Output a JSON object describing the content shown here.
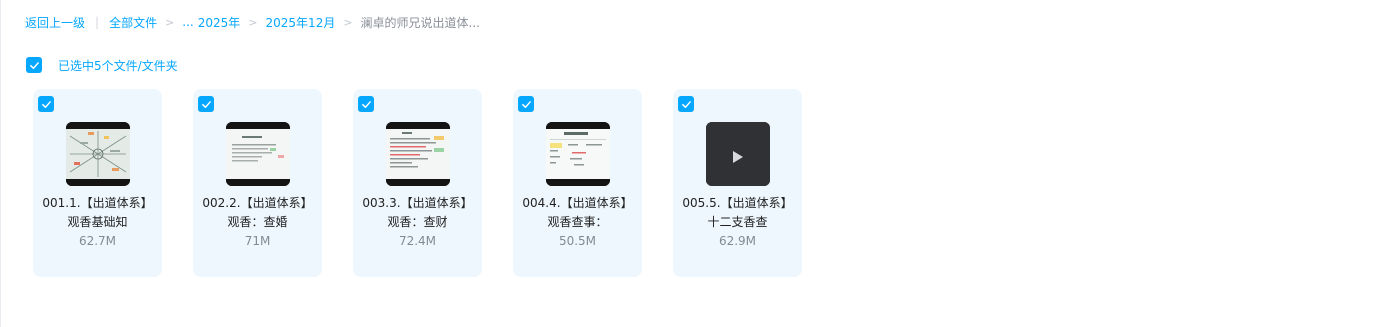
{
  "breadcrumb": {
    "back": "返回上一级",
    "all_files": "全部文件",
    "ellipsis": "...",
    "year": "2025年",
    "month": "2025年12月",
    "current": "澜卓的师兄说出道体..."
  },
  "selection": {
    "text": "已选中5个文件/文件夹"
  },
  "files": [
    {
      "name": "001.1.【出道体系】观香基础知",
      "size": "62.7M",
      "thumbnail": "diagram-slide"
    },
    {
      "name": "002.2.【出道体系】观香：查婚",
      "size": "71M",
      "thumbnail": "text-slide"
    },
    {
      "name": "003.3.【出道体系】观香：查财",
      "size": "72.4M",
      "thumbnail": "text-slide-highlight"
    },
    {
      "name": "004.4.【出道体系】观香查事：",
      "size": "50.5M",
      "thumbnail": "table-slide"
    },
    {
      "name": "005.5.【出道体系】十二支香查",
      "size": "62.9M",
      "thumbnail": "video-play-icon"
    }
  ],
  "colors": {
    "accent": "#06a7ff",
    "card_bg": "#eef7fe"
  }
}
